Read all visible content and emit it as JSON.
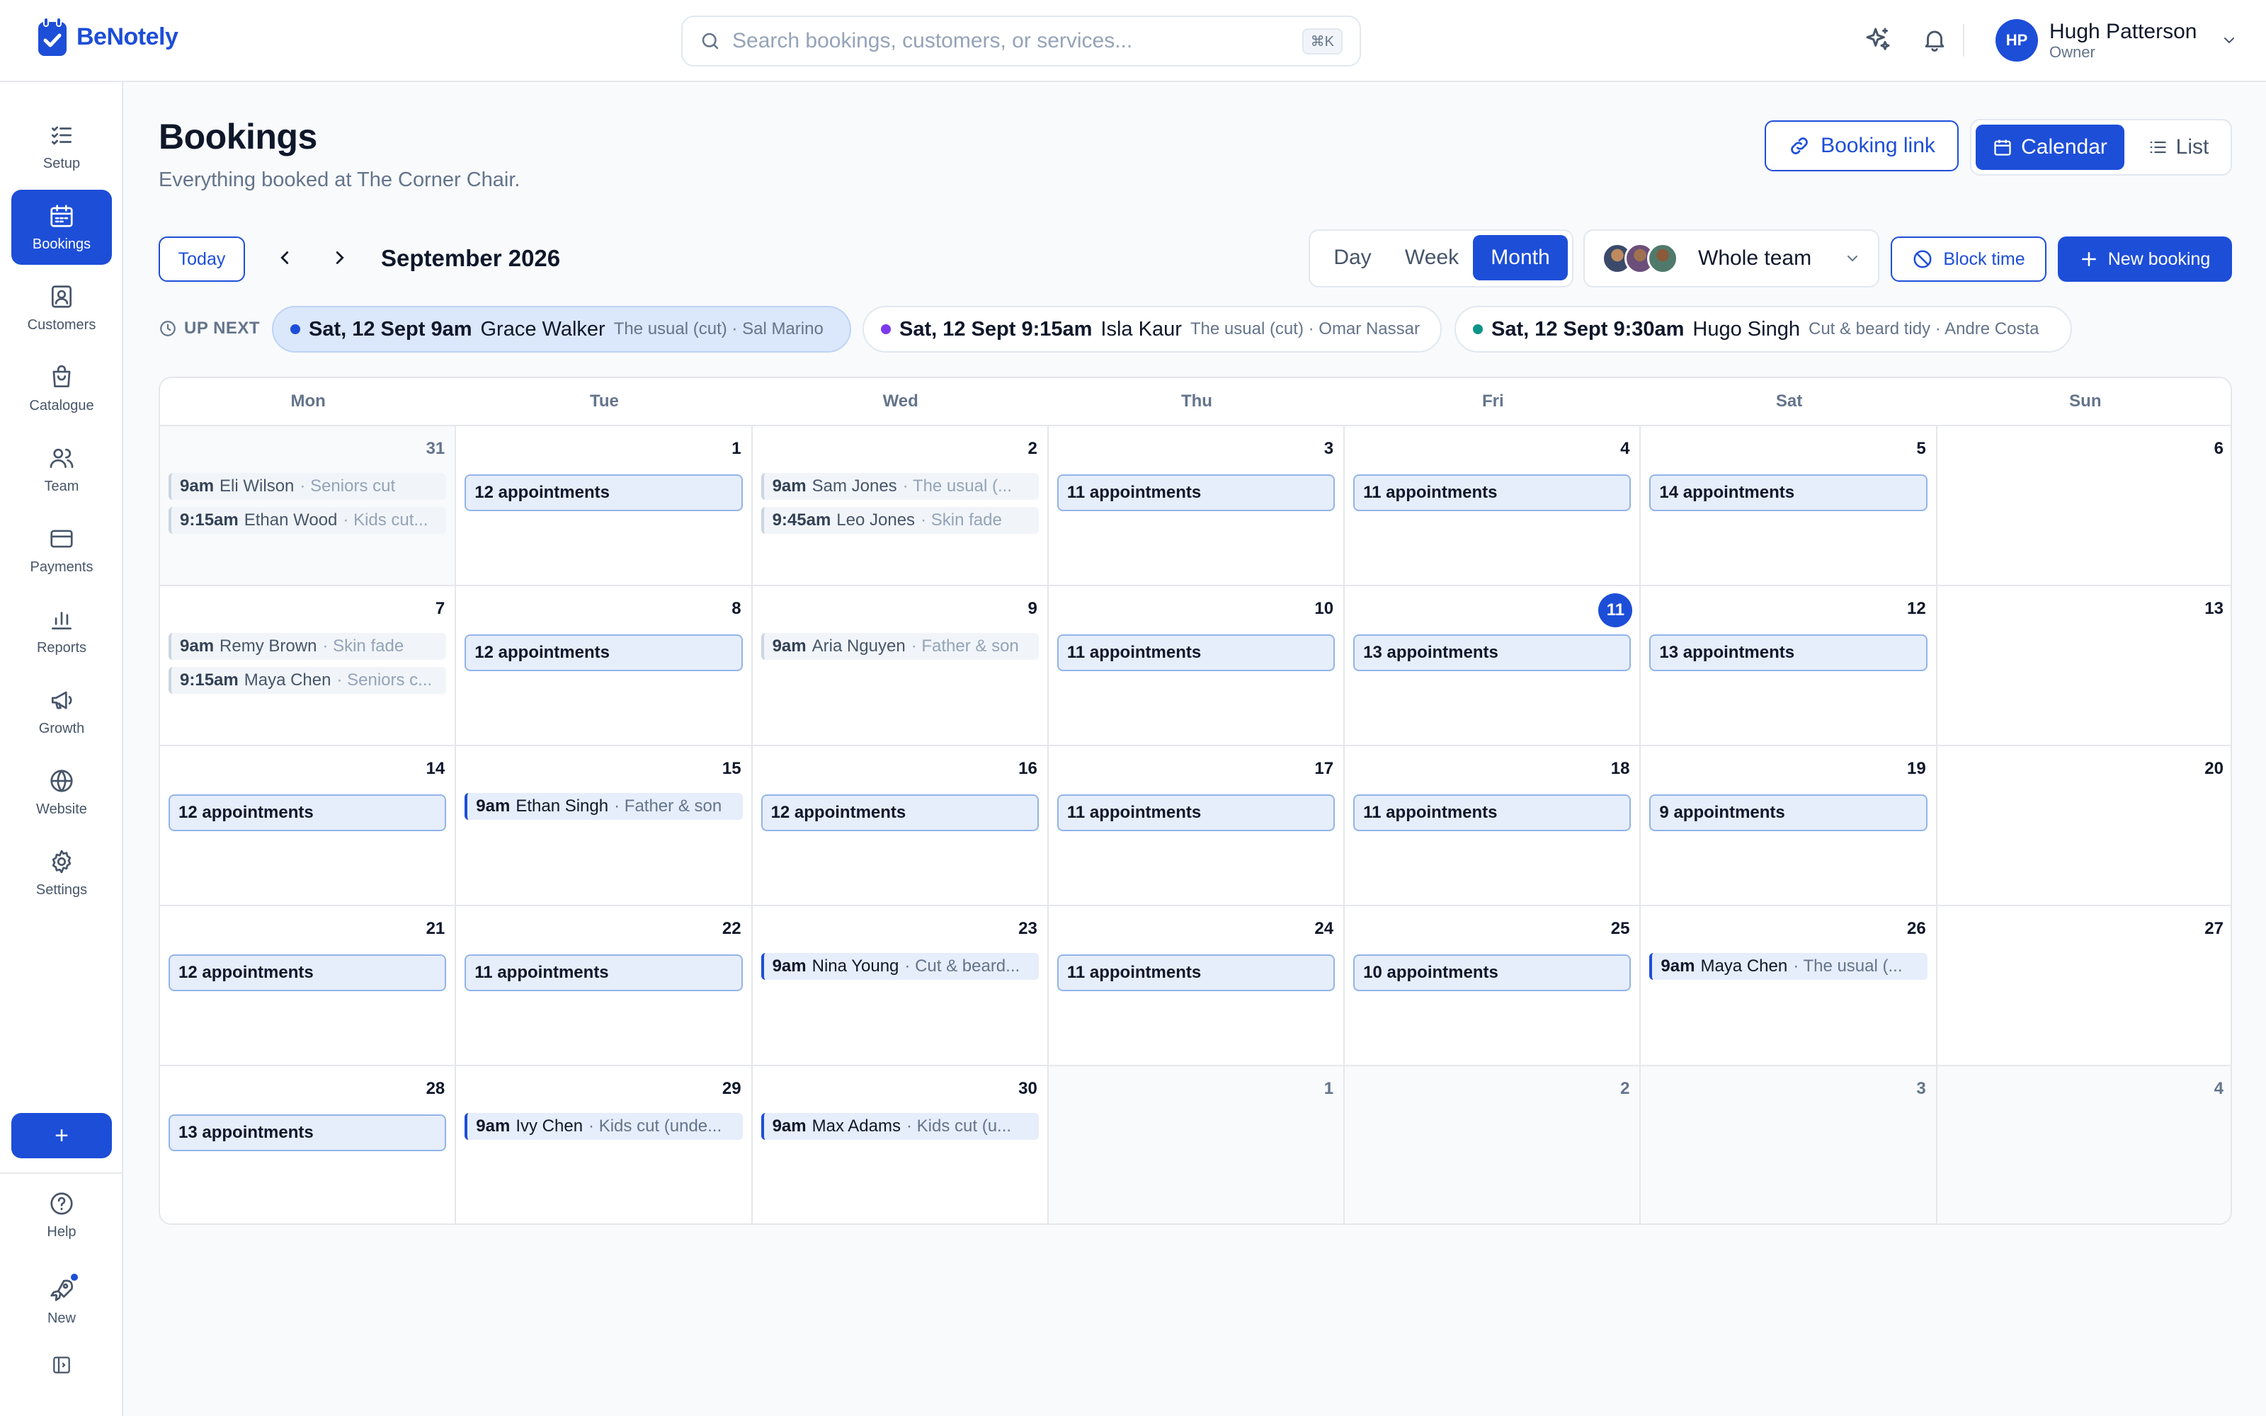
{
  "app": {
    "name": "BeNotely",
    "colors": {
      "primary": "#1d4ed8",
      "text": "#0f172a",
      "muted": "#64748b",
      "border": "#e5e7eb"
    }
  },
  "header": {
    "search_placeholder": "Search bookings, customers, or services...",
    "search_shortcut": "⌘K",
    "user": {
      "initials": "HP",
      "name": "Hugh Patterson",
      "role": "Owner"
    }
  },
  "sidebar": {
    "items": [
      {
        "id": "setup",
        "label": "Setup",
        "icon": "checklist-icon"
      },
      {
        "id": "bookings",
        "label": "Bookings",
        "icon": "calendar-icon",
        "active": true
      },
      {
        "id": "customers",
        "label": "Customers",
        "icon": "contact-icon"
      },
      {
        "id": "catalogue",
        "label": "Catalogue",
        "icon": "bag-icon"
      },
      {
        "id": "team",
        "label": "Team",
        "icon": "users-icon"
      },
      {
        "id": "payments",
        "label": "Payments",
        "icon": "card-icon"
      },
      {
        "id": "reports",
        "label": "Reports",
        "icon": "bar-chart-icon"
      },
      {
        "id": "growth",
        "label": "Growth",
        "icon": "megaphone-icon"
      },
      {
        "id": "website",
        "label": "Website",
        "icon": "globe-icon"
      },
      {
        "id": "settings",
        "label": "Settings",
        "icon": "gear-icon"
      }
    ],
    "add_label": "+",
    "help_label": "Help",
    "new_label": "New"
  },
  "page": {
    "title": "Bookings",
    "subtitle": "Everything booked at The Corner Chair.",
    "booking_link_label": "Booking link",
    "view_calendar": "Calendar",
    "view_list": "List"
  },
  "toolbar": {
    "today": "Today",
    "month_label": "September 2026",
    "range": [
      "Day",
      "Week",
      "Month"
    ],
    "range_active": "Month",
    "team_label": "Whole team",
    "block_time": "Block time",
    "new_booking": "New booking"
  },
  "up_next": {
    "label": "UP NEXT",
    "items": [
      {
        "time": "Sat, 12 Sept 9am",
        "name": "Grace Walker",
        "desc": "The usual (cut) · Sal Marino",
        "color": "#1d4ed8"
      },
      {
        "time": "Sat, 12 Sept 9:15am",
        "name": "Isla Kaur",
        "desc": "The usual (cut) · Omar Nassar",
        "color": "#7c3aed"
      },
      {
        "time": "Sat, 12 Sept 9:30am",
        "name": "Hugo Singh",
        "desc": "Cut & beard tidy · Andre Costa",
        "color": "#0d9488"
      }
    ]
  },
  "calendar": {
    "weekdays": [
      "Mon",
      "Tue",
      "Wed",
      "Thu",
      "Fri",
      "Sat",
      "Sun"
    ],
    "weeks": [
      [
        {
          "day": "31",
          "other": true,
          "appts": [
            {
              "time": "9am",
              "name": "Eli Wilson",
              "service": "Seniors cut",
              "style": "past"
            },
            {
              "time": "9:15am",
              "name": "Ethan Wood",
              "service": "Kids cut...",
              "style": "past"
            }
          ]
        },
        {
          "day": "1",
          "count": "12 appointments"
        },
        {
          "day": "2",
          "appts": [
            {
              "time": "9am",
              "name": "Sam Jones",
              "service": "The usual (...",
              "style": "past"
            },
            {
              "time": "9:45am",
              "name": "Leo Jones",
              "service": "Skin fade",
              "style": "past"
            }
          ]
        },
        {
          "day": "3",
          "count": "11 appointments"
        },
        {
          "day": "4",
          "count": "11 appointments"
        },
        {
          "day": "5",
          "count": "14 appointments"
        },
        {
          "day": "6"
        }
      ],
      [
        {
          "day": "7",
          "appts": [
            {
              "time": "9am",
              "name": "Remy Brown",
              "service": "Skin fade",
              "style": "past"
            },
            {
              "time": "9:15am",
              "name": "Maya Chen",
              "service": "Seniors c...",
              "style": "past"
            }
          ]
        },
        {
          "day": "8",
          "count": "12 appointments"
        },
        {
          "day": "9",
          "appts": [
            {
              "time": "9am",
              "name": "Aria Nguyen",
              "service": "Father & son",
              "style": "past"
            }
          ]
        },
        {
          "day": "10",
          "count": "11 appointments"
        },
        {
          "day": "11",
          "today": true,
          "count": "13 appointments"
        },
        {
          "day": "12",
          "count": "13 appointments"
        },
        {
          "day": "13"
        }
      ],
      [
        {
          "day": "14",
          "count": "12 appointments"
        },
        {
          "day": "15",
          "appts": [
            {
              "time": "9am",
              "name": "Ethan Singh",
              "service": "Father & son",
              "style": "upcoming"
            }
          ]
        },
        {
          "day": "16",
          "count": "12 appointments"
        },
        {
          "day": "17",
          "count": "11 appointments"
        },
        {
          "day": "18",
          "count": "11 appointments"
        },
        {
          "day": "19",
          "count": "9 appointments"
        },
        {
          "day": "20"
        }
      ],
      [
        {
          "day": "21",
          "count": "12 appointments"
        },
        {
          "day": "22",
          "count": "11 appointments"
        },
        {
          "day": "23",
          "appts": [
            {
              "time": "9am",
              "name": "Nina Young",
              "service": "Cut & beard...",
              "style": "upcoming"
            }
          ]
        },
        {
          "day": "24",
          "count": "11 appointments"
        },
        {
          "day": "25",
          "count": "10 appointments"
        },
        {
          "day": "26",
          "appts": [
            {
              "time": "9am",
              "name": "Maya Chen",
              "service": "The usual (...",
              "style": "upcoming"
            }
          ]
        },
        {
          "day": "27"
        }
      ],
      [
        {
          "day": "28",
          "count": "13 appointments"
        },
        {
          "day": "29",
          "appts": [
            {
              "time": "9am",
              "name": "Ivy Chen",
              "service": "Kids cut (unde...",
              "style": "upcoming"
            }
          ]
        },
        {
          "day": "30",
          "appts": [
            {
              "time": "9am",
              "name": "Max Adams",
              "service": "Kids cut (u...",
              "style": "upcoming"
            }
          ]
        },
        {
          "day": "1",
          "other": true
        },
        {
          "day": "2",
          "other": true
        },
        {
          "day": "3",
          "other": true
        },
        {
          "day": "4",
          "other": true
        }
      ]
    ]
  }
}
